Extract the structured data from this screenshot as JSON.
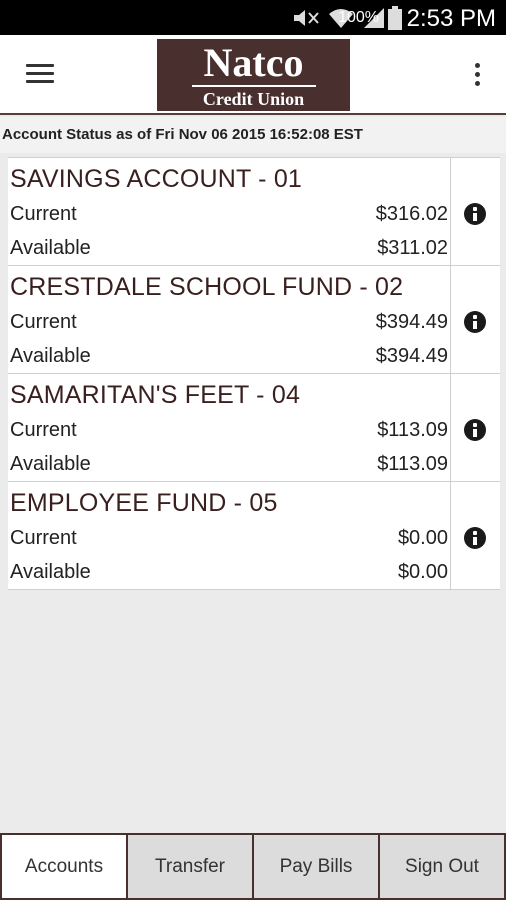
{
  "statusbar": {
    "battery_percent": "100%",
    "time": "2:53 PM"
  },
  "appbar": {
    "logo_name": "Natco",
    "logo_subtitle": "Credit Union"
  },
  "account_status": "Account Status as of Fri Nov 06 2015 16:52:08 EST",
  "accounts": [
    {
      "title": "SAVINGS ACCOUNT - 01",
      "current_label": "Current",
      "current": "$316.02",
      "available_label": "Available",
      "available": "$311.02"
    },
    {
      "title": "CRESTDALE SCHOOL FUND - 02",
      "current_label": "Current",
      "current": "$394.49",
      "available_label": "Available",
      "available": "$394.49"
    },
    {
      "title": "SAMARITAN'S FEET - 04",
      "current_label": "Current",
      "current": "$113.09",
      "available_label": "Available",
      "available": "$113.09"
    },
    {
      "title": "EMPLOYEE FUND - 05",
      "current_label": "Current",
      "current": "$0.00",
      "available_label": "Available",
      "available": "$0.00"
    }
  ],
  "tabs": [
    {
      "label": "Accounts",
      "active": true
    },
    {
      "label": "Transfer",
      "active": false
    },
    {
      "label": "Pay Bills",
      "active": false
    },
    {
      "label": "Sign Out",
      "active": false
    }
  ],
  "colors": {
    "brand": "#4a2f2f",
    "title_text": "#3a1f1f",
    "background": "#ebebeb"
  }
}
